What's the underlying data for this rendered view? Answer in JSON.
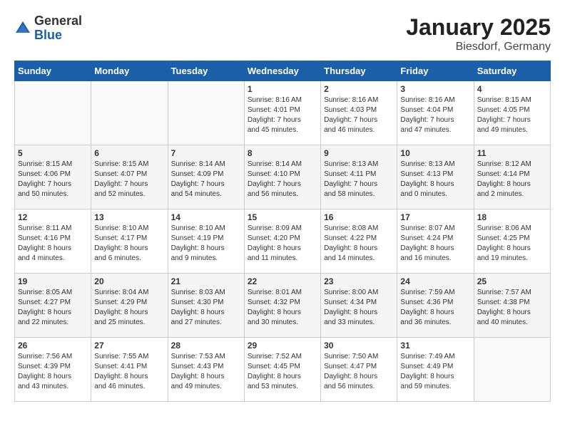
{
  "header": {
    "logo_general": "General",
    "logo_blue": "Blue",
    "month_year": "January 2025",
    "location": "Biesdorf, Germany"
  },
  "weekdays": [
    "Sunday",
    "Monday",
    "Tuesday",
    "Wednesday",
    "Thursday",
    "Friday",
    "Saturday"
  ],
  "weeks": [
    [
      {
        "day": "",
        "empty": true
      },
      {
        "day": "",
        "empty": true
      },
      {
        "day": "",
        "empty": true
      },
      {
        "day": "1",
        "info": "Sunrise: 8:16 AM\nSunset: 4:01 PM\nDaylight: 7 hours\nand 45 minutes."
      },
      {
        "day": "2",
        "info": "Sunrise: 8:16 AM\nSunset: 4:03 PM\nDaylight: 7 hours\nand 46 minutes."
      },
      {
        "day": "3",
        "info": "Sunrise: 8:16 AM\nSunset: 4:04 PM\nDaylight: 7 hours\nand 47 minutes."
      },
      {
        "day": "4",
        "info": "Sunrise: 8:15 AM\nSunset: 4:05 PM\nDaylight: 7 hours\nand 49 minutes."
      }
    ],
    [
      {
        "day": "5",
        "info": "Sunrise: 8:15 AM\nSunset: 4:06 PM\nDaylight: 7 hours\nand 50 minutes."
      },
      {
        "day": "6",
        "info": "Sunrise: 8:15 AM\nSunset: 4:07 PM\nDaylight: 7 hours\nand 52 minutes."
      },
      {
        "day": "7",
        "info": "Sunrise: 8:14 AM\nSunset: 4:09 PM\nDaylight: 7 hours\nand 54 minutes."
      },
      {
        "day": "8",
        "info": "Sunrise: 8:14 AM\nSunset: 4:10 PM\nDaylight: 7 hours\nand 56 minutes."
      },
      {
        "day": "9",
        "info": "Sunrise: 8:13 AM\nSunset: 4:11 PM\nDaylight: 7 hours\nand 58 minutes."
      },
      {
        "day": "10",
        "info": "Sunrise: 8:13 AM\nSunset: 4:13 PM\nDaylight: 8 hours\nand 0 minutes."
      },
      {
        "day": "11",
        "info": "Sunrise: 8:12 AM\nSunset: 4:14 PM\nDaylight: 8 hours\nand 2 minutes."
      }
    ],
    [
      {
        "day": "12",
        "info": "Sunrise: 8:11 AM\nSunset: 4:16 PM\nDaylight: 8 hours\nand 4 minutes."
      },
      {
        "day": "13",
        "info": "Sunrise: 8:10 AM\nSunset: 4:17 PM\nDaylight: 8 hours\nand 6 minutes."
      },
      {
        "day": "14",
        "info": "Sunrise: 8:10 AM\nSunset: 4:19 PM\nDaylight: 8 hours\nand 9 minutes."
      },
      {
        "day": "15",
        "info": "Sunrise: 8:09 AM\nSunset: 4:20 PM\nDaylight: 8 hours\nand 11 minutes."
      },
      {
        "day": "16",
        "info": "Sunrise: 8:08 AM\nSunset: 4:22 PM\nDaylight: 8 hours\nand 14 minutes."
      },
      {
        "day": "17",
        "info": "Sunrise: 8:07 AM\nSunset: 4:24 PM\nDaylight: 8 hours\nand 16 minutes."
      },
      {
        "day": "18",
        "info": "Sunrise: 8:06 AM\nSunset: 4:25 PM\nDaylight: 8 hours\nand 19 minutes."
      }
    ],
    [
      {
        "day": "19",
        "info": "Sunrise: 8:05 AM\nSunset: 4:27 PM\nDaylight: 8 hours\nand 22 minutes."
      },
      {
        "day": "20",
        "info": "Sunrise: 8:04 AM\nSunset: 4:29 PM\nDaylight: 8 hours\nand 25 minutes."
      },
      {
        "day": "21",
        "info": "Sunrise: 8:03 AM\nSunset: 4:30 PM\nDaylight: 8 hours\nand 27 minutes."
      },
      {
        "day": "22",
        "info": "Sunrise: 8:01 AM\nSunset: 4:32 PM\nDaylight: 8 hours\nand 30 minutes."
      },
      {
        "day": "23",
        "info": "Sunrise: 8:00 AM\nSunset: 4:34 PM\nDaylight: 8 hours\nand 33 minutes."
      },
      {
        "day": "24",
        "info": "Sunrise: 7:59 AM\nSunset: 4:36 PM\nDaylight: 8 hours\nand 36 minutes."
      },
      {
        "day": "25",
        "info": "Sunrise: 7:57 AM\nSunset: 4:38 PM\nDaylight: 8 hours\nand 40 minutes."
      }
    ],
    [
      {
        "day": "26",
        "info": "Sunrise: 7:56 AM\nSunset: 4:39 PM\nDaylight: 8 hours\nand 43 minutes."
      },
      {
        "day": "27",
        "info": "Sunrise: 7:55 AM\nSunset: 4:41 PM\nDaylight: 8 hours\nand 46 minutes."
      },
      {
        "day": "28",
        "info": "Sunrise: 7:53 AM\nSunset: 4:43 PM\nDaylight: 8 hours\nand 49 minutes."
      },
      {
        "day": "29",
        "info": "Sunrise: 7:52 AM\nSunset: 4:45 PM\nDaylight: 8 hours\nand 53 minutes."
      },
      {
        "day": "30",
        "info": "Sunrise: 7:50 AM\nSunset: 4:47 PM\nDaylight: 8 hours\nand 56 minutes."
      },
      {
        "day": "31",
        "info": "Sunrise: 7:49 AM\nSunset: 4:49 PM\nDaylight: 8 hours\nand 59 minutes."
      },
      {
        "day": "",
        "empty": true
      }
    ]
  ]
}
